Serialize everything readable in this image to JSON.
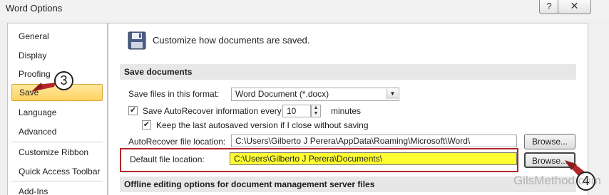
{
  "window": {
    "title": "Word Options",
    "help_glyph": "?",
    "close_glyph": "✕"
  },
  "nav": {
    "items": [
      {
        "label": "General"
      },
      {
        "label": "Display"
      },
      {
        "label": "Proofing"
      },
      {
        "label": "Save",
        "selected": true
      },
      {
        "label": "Language"
      },
      {
        "label": "Advanced"
      },
      {
        "label": "Customize Ribbon"
      },
      {
        "label": "Quick Access Toolbar"
      },
      {
        "label": "Add-Ins"
      }
    ]
  },
  "main": {
    "heading": "Customize how documents are saved.",
    "save_section": {
      "title": "Save documents",
      "format_label": "Save files in this format:",
      "format_value": "Word Document (*.docx)",
      "autorecover_label": "Save AutoRecover information every",
      "autorecover_checked": true,
      "autorecover_minutes": "10",
      "minutes_label": "minutes",
      "keep_label": "Keep the last autosaved version if I close without saving",
      "keep_checked": true,
      "ar_location_label": "AutoRecover file location:",
      "ar_location_value": "C:\\Users\\Gilberto J Perera\\AppData\\Roaming\\Microsoft\\Word\\",
      "default_location_label": "Default file location:",
      "default_location_value": "C:\\Users\\Gilberto J Perera\\Documents\\",
      "browse_label": "Browse..."
    },
    "offline_section": {
      "title": "Offline editing options for document management server files"
    }
  },
  "annotations": {
    "callout_3": "3",
    "callout_4": "4",
    "watermark": "GilsMethod.com"
  },
  "colors": {
    "highlight": "#ffff33",
    "annotation_red": "#b3262a",
    "selected_nav": "#ffd262"
  }
}
